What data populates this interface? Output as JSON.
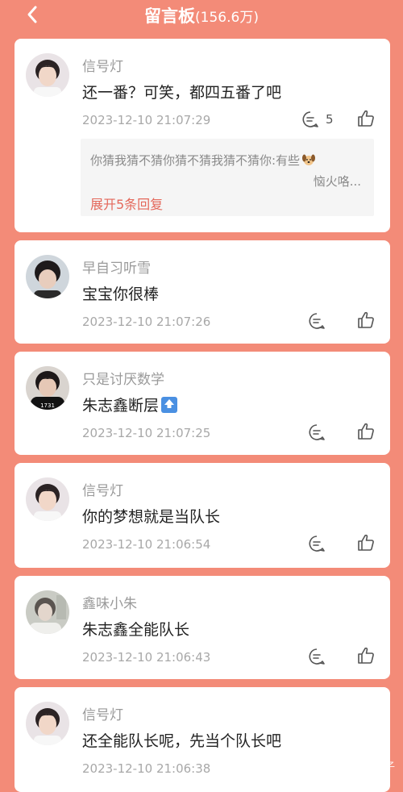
{
  "header": {
    "title": "留言板",
    "count": "(156.6万)"
  },
  "messages": [
    {
      "user": "信号灯",
      "text": "还一番？可笑，都四五番了吧",
      "time": "2023-12-10 21:07:29",
      "comment_count": "5",
      "reply_preview_line1": "你猜我猜不猜你猜不猜我猜不猜你:有些",
      "reply_preview_line2": "恼火咯...",
      "expand_label": "展开5条回复"
    },
    {
      "user": "早自习听雪",
      "text": "宝宝你很棒",
      "time": "2023-12-10 21:07:26"
    },
    {
      "user": "只是讨厌数学",
      "text": "朱志鑫断层",
      "time": "2023-12-10 21:07:25",
      "avatar_shirt_text": "1731"
    },
    {
      "user": "信号灯",
      "text": "你的梦想就是当队长",
      "time": "2023-12-10 21:06:54"
    },
    {
      "user": "鑫味小朱",
      "text": "朱志鑫全能队长",
      "time": "2023-12-10 21:06:43"
    },
    {
      "user": "信号灯",
      "text": "还全能队长呢，先当个队长吧",
      "time": "2023-12-10 21:06:38"
    }
  ],
  "watermark": "@鲸鱼团子",
  "icons": {
    "back": "chevron-left-icon",
    "comment": "comment-bubble-icon",
    "like": "thumbs-up-icon",
    "top": "top-arrow-icon",
    "dog": "dog-face-icon"
  },
  "colors": {
    "background": "#F38B78",
    "card": "#FFFFFF",
    "accent_link": "#E4685B"
  }
}
